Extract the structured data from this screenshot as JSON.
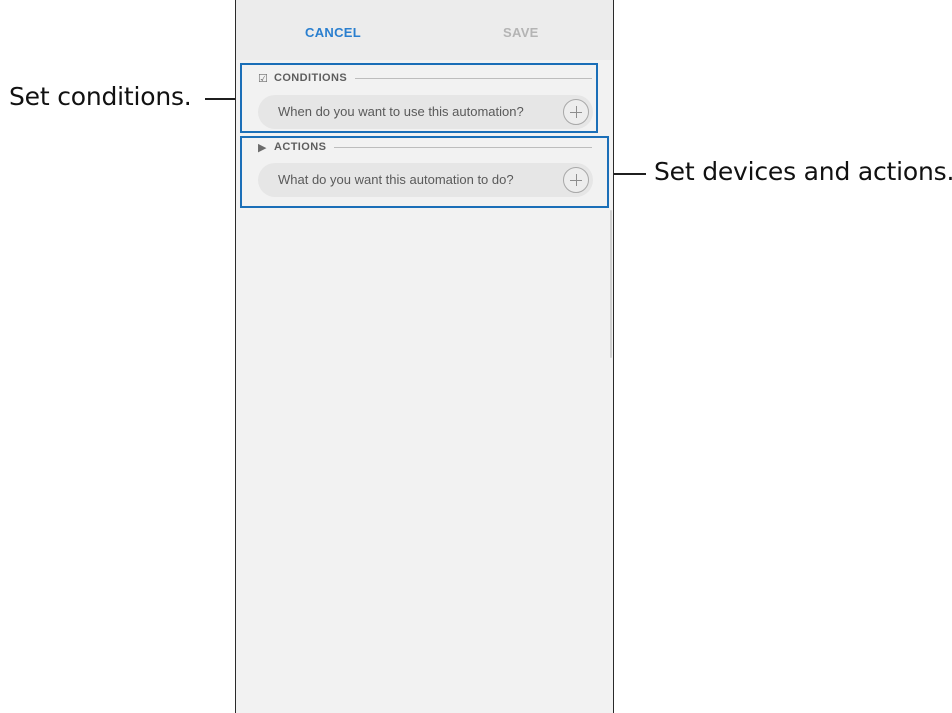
{
  "callouts": {
    "conditions": "Set conditions.",
    "actions": "Set devices and actions."
  },
  "toolbar": {
    "cancel_label": "CANCEL",
    "save_label": "SAVE"
  },
  "conditions": {
    "header": "CONDITIONS",
    "icon": "checkbox-icon",
    "placeholder": "When do you want to use this automation?",
    "add_icon": "plus-icon"
  },
  "actions": {
    "header": "ACTIONS",
    "icon": "play-triangle-icon",
    "placeholder": "What do you want this automation to do?",
    "add_icon": "plus-icon"
  },
  "colors": {
    "accent": "#2a7fcf",
    "highlight": "#1b6fb8",
    "disabled": "#b4b4b4"
  }
}
